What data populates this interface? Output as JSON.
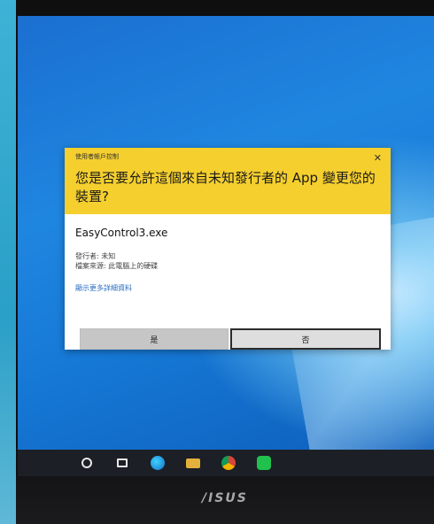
{
  "dialog": {
    "caption": "使用者帳戶控制",
    "close": "✕",
    "question": "您是否要允許這個來自未知發行者的 App 變更您的裝置?",
    "app_name": "EasyControl3.exe",
    "publisher": "發行者: 未知",
    "file_origin": "檔案來源: 此電腦上的硬碟",
    "details_link": "顯示更多詳細資料",
    "yes": "是",
    "no": "否"
  },
  "monitor": {
    "brand": "/ISUS"
  },
  "taskbar": {
    "icons": [
      "search-icon",
      "task-view-icon",
      "edge-icon",
      "file-explorer-icon",
      "chrome-icon",
      "line-icon"
    ]
  },
  "colors": {
    "header": "#f5cf2e",
    "link": "#2a6fc2"
  }
}
